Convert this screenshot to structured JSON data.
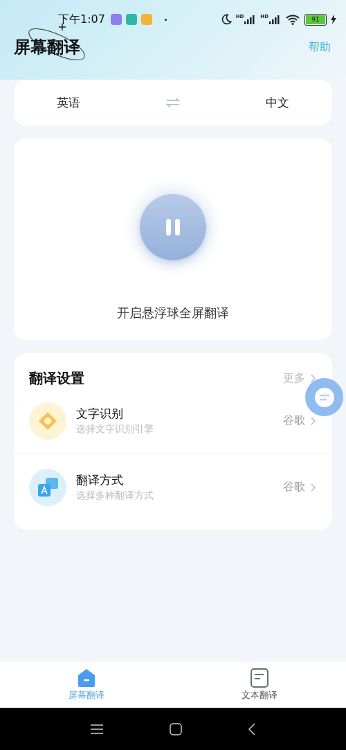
{
  "status_bar": {
    "time": "下午1:07",
    "signal_labels": [
      "HD",
      "HD"
    ],
    "battery": "91",
    "charging": true
  },
  "header": {
    "title": "屏幕翻译",
    "help": "帮助"
  },
  "languages": {
    "source": "英语",
    "target": "中文"
  },
  "float_panel": {
    "caption": "开启悬浮球全屏翻译",
    "running": true
  },
  "settings": {
    "title": "翻译设置",
    "more": "更多",
    "items": [
      {
        "kind": "ocr",
        "title": "文字识别",
        "subtitle": "选择文字识别引擎",
        "value": "谷歌"
      },
      {
        "kind": "translate",
        "title": "翻译方式",
        "subtitle": "选择多种翻译方式",
        "value": "谷歌"
      }
    ]
  },
  "bottom_nav": [
    {
      "label": "屏幕翻译",
      "kind": "screen",
      "selected": true
    },
    {
      "label": "文本翻译",
      "kind": "text",
      "selected": false
    }
  ]
}
